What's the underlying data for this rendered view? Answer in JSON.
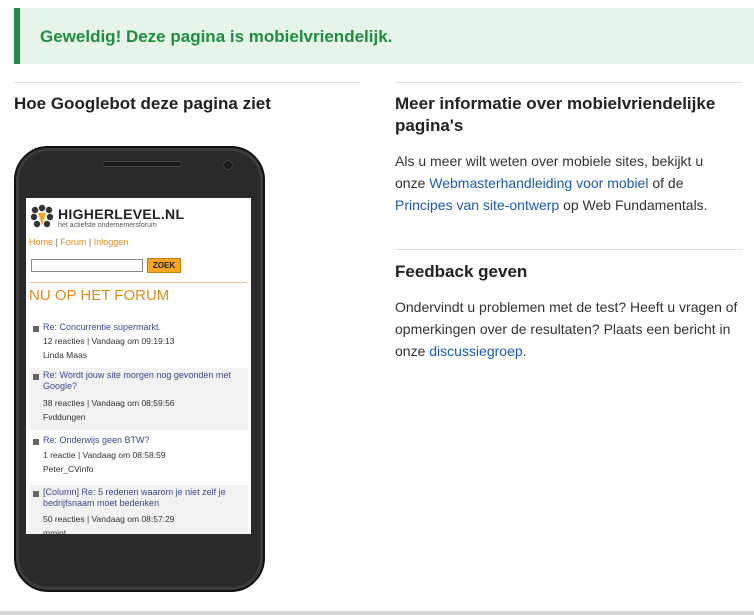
{
  "banner": {
    "text": "Geweldig! Deze pagina is mobielvriendelijk."
  },
  "left": {
    "heading": "Hoe Googlebot deze pagina ziet"
  },
  "preview": {
    "brand": "HIGHERLEVEL.NL",
    "brand_sub": "het actiefste ondernemersforum",
    "nav": [
      "Home",
      "Forum",
      "Inloggen"
    ],
    "nav_separator": "|",
    "search_button": "ZOEK",
    "section_title": "NU OP HET FORUM",
    "posts": [
      {
        "title": "Re: Concurrentie supermarkt.",
        "meta": "12 reacties | Vandaag om 09:19:13",
        "author": "Linda Maas"
      },
      {
        "title": "Re: Wordt jouw site morgen nog gevonden met Google?",
        "meta": "38 reacties | Vandaag om 08:59:56",
        "author": "Fvddungen"
      },
      {
        "title": "Re: Onderwijs geen BTW?",
        "meta": "1 reactie | Vandaag om 08:58:59",
        "author": "Peter_CVinfo"
      },
      {
        "title": "[Column] Re: 5 redenen waarom je niet zelf je bedrijfsnaam moet bedenken",
        "meta": "50 reacties | Vandaag om 08:57:29",
        "author": "mmint"
      }
    ]
  },
  "info": {
    "heading": "Meer informatie over mobielvriendelijke pagina's",
    "text_1": "Als u meer wilt weten over mobiele sites, bekijkt u onze",
    "link_1": "Webmasterhandleiding voor mobiel",
    "text_2": "of de",
    "link_2": "Principes van site-ontwerp",
    "text_3": "op Web Fundamentals."
  },
  "feedback": {
    "heading": "Feedback geven",
    "text_1": "Ondervindt u problemen met de test? Heeft u vragen of opmerkingen over de resultaten? Plaats een bericht in onze",
    "link": "discussiegroep",
    "text_2": "."
  },
  "colors": {
    "success": "#1e8e3e",
    "banner_bg": "#e6f4ea",
    "link": "#1a5bb5",
    "accent_orange": "#e08a1e"
  }
}
